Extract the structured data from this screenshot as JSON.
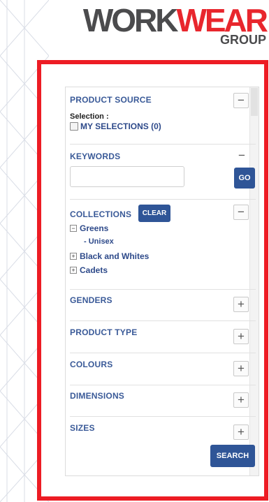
{
  "logo": {
    "work": "WORK",
    "wear": "WEAR",
    "group": "GROUP"
  },
  "filters": {
    "product_source": {
      "title": "PRODUCT SOURCE",
      "toggle": "−",
      "selection_label": "Selection :",
      "my_selections": "MY SELECTIONS (0)"
    },
    "keywords": {
      "title": "KEYWORDS",
      "toggle": "−",
      "input_value": "",
      "go_label": "GO"
    },
    "collections": {
      "title": "COLLECTIONS",
      "toggle": "−",
      "clear_label": "CLEAR",
      "items": [
        {
          "expander": "−",
          "label": "Greens"
        },
        {
          "label": "- Unisex"
        },
        {
          "expander": "+",
          "label": "Black and Whites"
        },
        {
          "expander": "+",
          "label": "Cadets"
        }
      ]
    },
    "genders": {
      "title": "GENDERS",
      "toggle": "+"
    },
    "product_type": {
      "title": "PRODUCT TYPE",
      "toggle": "+"
    },
    "colours": {
      "title": "COLOURS",
      "toggle": "+"
    },
    "dimensions": {
      "title": "DIMENSIONS",
      "toggle": "+"
    },
    "sizes": {
      "title": "SIZES",
      "toggle": "+"
    },
    "search_label": "SEARCH"
  },
  "colors": {
    "frame": "#ed1c24",
    "button": "#2f5597",
    "heading": "#3a5a98",
    "logo_red": "#e8262d",
    "logo_grey": "#4b4b4d"
  }
}
